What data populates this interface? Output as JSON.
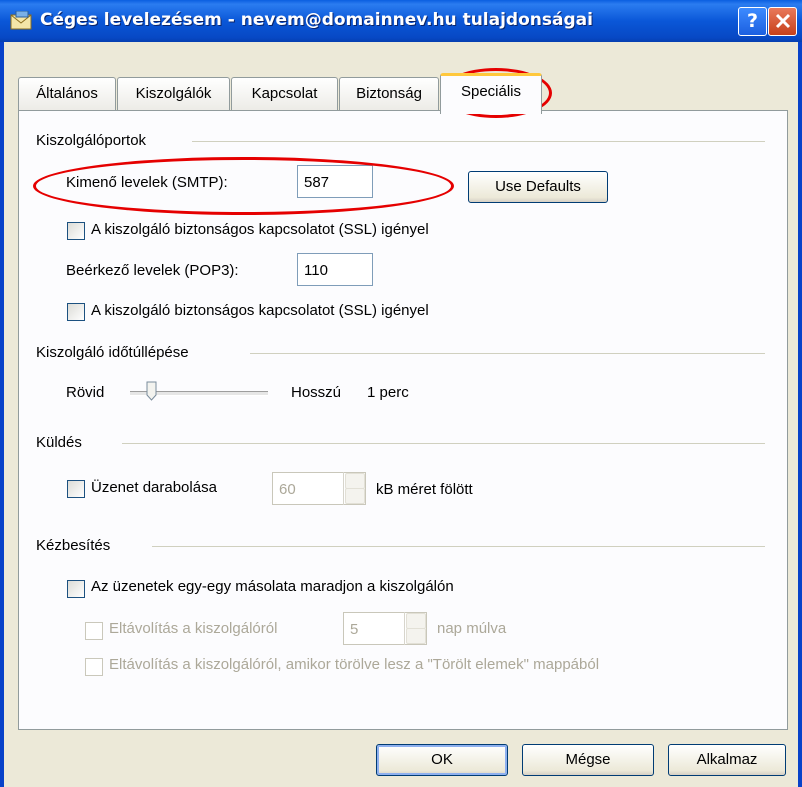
{
  "window": {
    "title": "Céges levelezésem - nevem@domainnev.hu tulajdonságai",
    "help_label": "?",
    "close_label": "X"
  },
  "tabs": [
    {
      "label": "Általános"
    },
    {
      "label": "Kiszolgálók"
    },
    {
      "label": "Kapcsolat"
    },
    {
      "label": "Biztonság"
    },
    {
      "label": "Speciális",
      "active": true
    }
  ],
  "ports": {
    "group_title": "Kiszolgálóportok",
    "smtp_label": "Kimenő levelek (SMTP):",
    "smtp_value": "587",
    "use_defaults_label": "Use Defaults",
    "smtp_ssl_label": "A kiszolgáló biztonságos kapcsolatot (SSL) igényel",
    "pop3_label": "Beérkező levelek (POP3):",
    "pop3_value": "110",
    "pop3_ssl_label": "A kiszolgáló biztonságos kapcsolatot (SSL) igényel"
  },
  "timeout": {
    "group_title": "Kiszolgáló időtúllépése",
    "short_label": "Rövid",
    "long_label": "Hosszú",
    "value_text": "1 perc"
  },
  "sending": {
    "group_title": "Küldés",
    "split_label": "Üzenet darabolása",
    "split_value": "60",
    "split_unit": "kB méret fölött"
  },
  "delivery": {
    "group_title": "Kézbesítés",
    "keep_copy_label": "Az üzenetek egy-egy másolata maradjon a kiszolgálón",
    "remove_after_label": "Eltávolítás a kiszolgálóról",
    "remove_after_value": "5",
    "remove_after_unit": "nap múlva",
    "remove_deleted_label": "Eltávolítás a kiszolgálóról, amikor törölve lesz a \"Törölt elemek\" mappából"
  },
  "buttons": {
    "ok": "OK",
    "cancel": "Mégse",
    "apply": "Alkalmaz"
  },
  "colors": {
    "titlebar": "#0a57d8",
    "dialog_bg": "#ece9d8",
    "tab_accent": "#ffc83c",
    "annotation": "#e50000"
  }
}
